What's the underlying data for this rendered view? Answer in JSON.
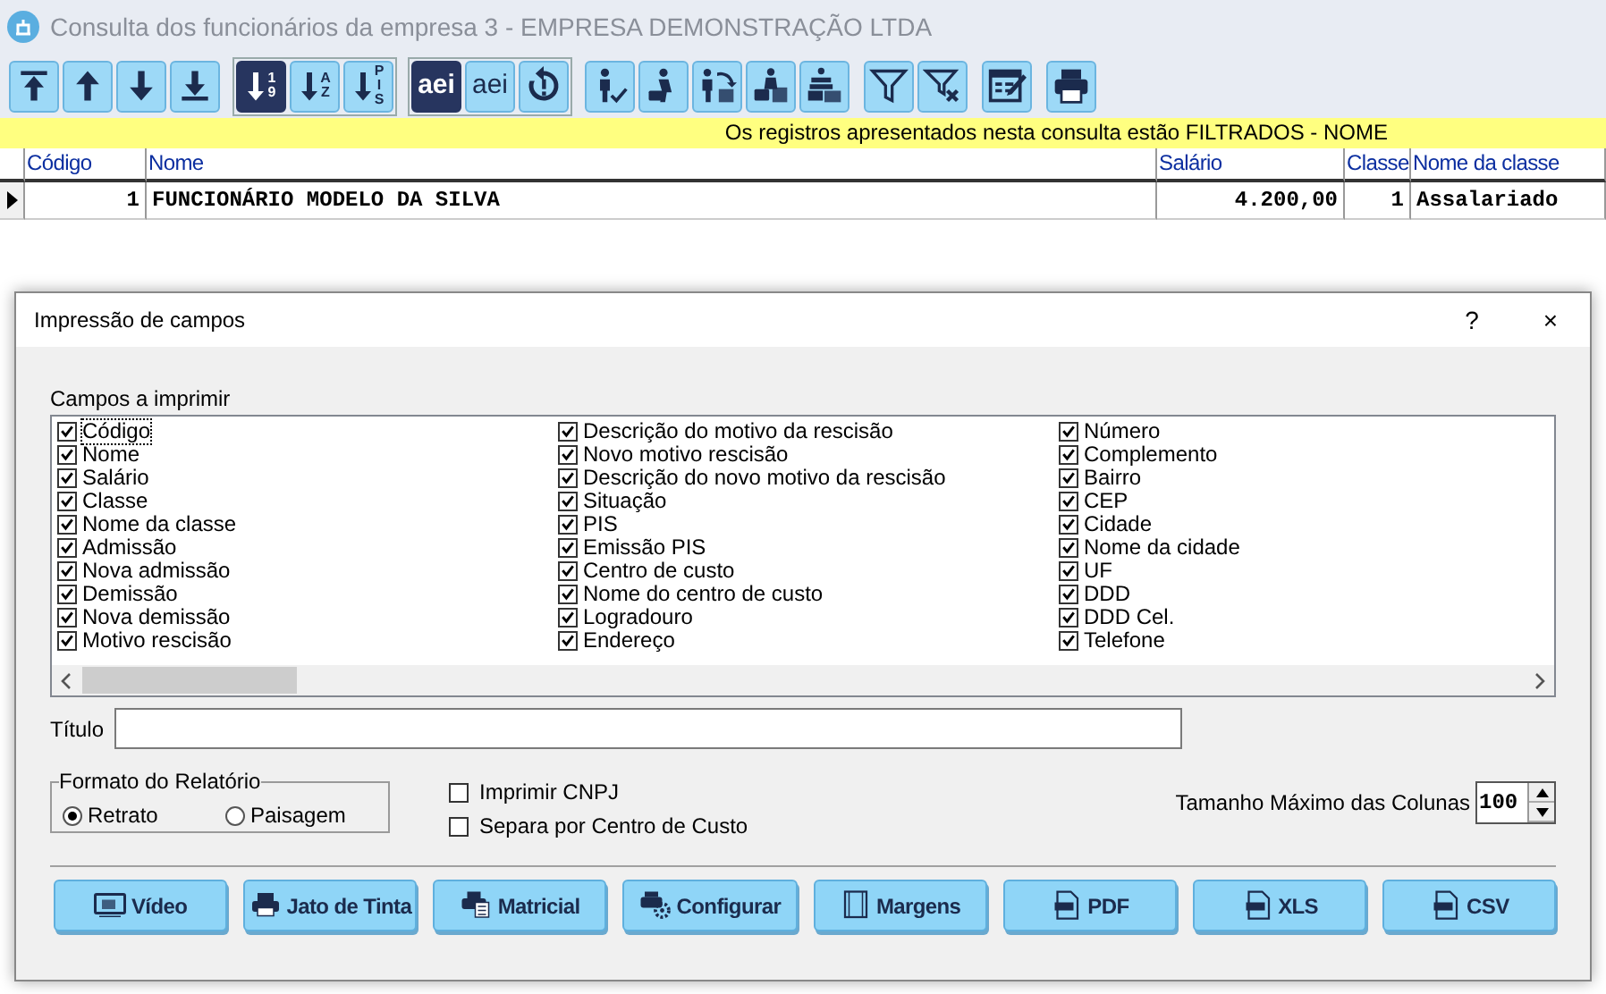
{
  "window": {
    "title": "Consulta dos funcionários da empresa 3 - EMPRESA DEMONSTRAÇÃO LTDA"
  },
  "toolbar": [
    [
      {
        "kind": "first",
        "selected": false
      },
      {
        "kind": "prev",
        "selected": false
      },
      {
        "kind": "next",
        "selected": false
      },
      {
        "kind": "last",
        "selected": false
      }
    ],
    [
      {
        "kind": "sort",
        "label": "19",
        "selected": true
      },
      {
        "kind": "sort",
        "label": "AZ",
        "selected": false
      },
      {
        "kind": "sort",
        "label": "PIS",
        "selected": false
      }
    ],
    [
      {
        "kind": "font",
        "label": "aei",
        "selected": true
      },
      {
        "kind": "font",
        "label": "aei",
        "selected": false
      },
      {
        "kind": "history",
        "selected": false
      }
    ],
    [
      {
        "kind": "person-check",
        "selected": false
      },
      {
        "kind": "person-cart",
        "selected": false
      },
      {
        "kind": "person-swap",
        "selected": false
      },
      {
        "kind": "person-table",
        "selected": false
      },
      {
        "kind": "stack-table",
        "selected": false
      }
    ],
    [
      {
        "kind": "filter",
        "selected": false
      },
      {
        "kind": "filter-clear",
        "selected": false
      }
    ],
    [
      {
        "kind": "form",
        "selected": false
      }
    ],
    [
      {
        "kind": "print",
        "selected": false
      }
    ]
  ],
  "filter_notice": "Os registros apresentados nesta consulta estão FILTRADOS - NOME",
  "table": {
    "columns": [
      "Código",
      "Nome",
      "Salário",
      "Classe",
      "Nome da classe"
    ],
    "rows": [
      {
        "selected": true,
        "cells": [
          "1",
          "FUNCIONÁRIO MODELO DA SILVA",
          "4.200,00",
          "1",
          "Assalariado"
        ]
      }
    ]
  },
  "dialog": {
    "title": "Impressão de campos",
    "help": "?",
    "close": "×",
    "fields_label": "Campos a imprimir",
    "fields": [
      [
        {
          "label": "Código",
          "checked": true
        },
        {
          "label": "Nome",
          "checked": true
        },
        {
          "label": "Salário",
          "checked": true
        },
        {
          "label": "Classe",
          "checked": true
        },
        {
          "label": "Nome da classe",
          "checked": true
        },
        {
          "label": "Admissão",
          "checked": true
        },
        {
          "label": "Nova admissão",
          "checked": true
        },
        {
          "label": "Demissão",
          "checked": true
        },
        {
          "label": "Nova demissão",
          "checked": true
        },
        {
          "label": "Motivo rescisão",
          "checked": true
        }
      ],
      [
        {
          "label": "Descrição do motivo da rescisão",
          "checked": true
        },
        {
          "label": "Novo motivo rescisão",
          "checked": true
        },
        {
          "label": "Descrição do novo motivo da rescisão",
          "checked": true
        },
        {
          "label": "Situação",
          "checked": true
        },
        {
          "label": "PIS",
          "checked": true
        },
        {
          "label": "Emissão PIS",
          "checked": true
        },
        {
          "label": "Centro de custo",
          "checked": true
        },
        {
          "label": "Nome do centro de custo",
          "checked": true
        },
        {
          "label": "Logradouro",
          "checked": true
        },
        {
          "label": "Endereço",
          "checked": true
        }
      ],
      [
        {
          "label": "Número",
          "checked": true
        },
        {
          "label": "Complemento",
          "checked": true
        },
        {
          "label": "Bairro",
          "checked": true
        },
        {
          "label": "CEP",
          "checked": true
        },
        {
          "label": "Cidade",
          "checked": true
        },
        {
          "label": "Nome da cidade",
          "checked": true
        },
        {
          "label": "UF",
          "checked": true
        },
        {
          "label": "DDD",
          "checked": true
        },
        {
          "label": "DDD Cel.",
          "checked": true
        },
        {
          "label": "Telefone",
          "checked": true
        }
      ]
    ],
    "title_label": "Título",
    "format": {
      "label": "Formato do Relatório",
      "options": [
        {
          "label": "Retrato",
          "selected": true
        },
        {
          "label": "Paisagem",
          "selected": false
        }
      ]
    },
    "options": [
      {
        "label": "Imprimir CNPJ",
        "checked": false
      },
      {
        "label": "Separa por Centro de Custo",
        "checked": false
      }
    ],
    "max_width": {
      "label": "Tamanho Máximo das Colunas",
      "value": "100"
    },
    "buttons": [
      {
        "kind": "screen",
        "label": "Vídeo"
      },
      {
        "kind": "printer",
        "label": "Jato de Tinta"
      },
      {
        "kind": "dotmatrix",
        "label": "Matricial"
      },
      {
        "kind": "config",
        "label": "Configurar"
      },
      {
        "kind": "margins",
        "label": "Margens"
      },
      {
        "kind": "file",
        "label": "PDF"
      },
      {
        "kind": "file",
        "label": "XLS"
      },
      {
        "kind": "file",
        "label": "CSV"
      }
    ]
  }
}
